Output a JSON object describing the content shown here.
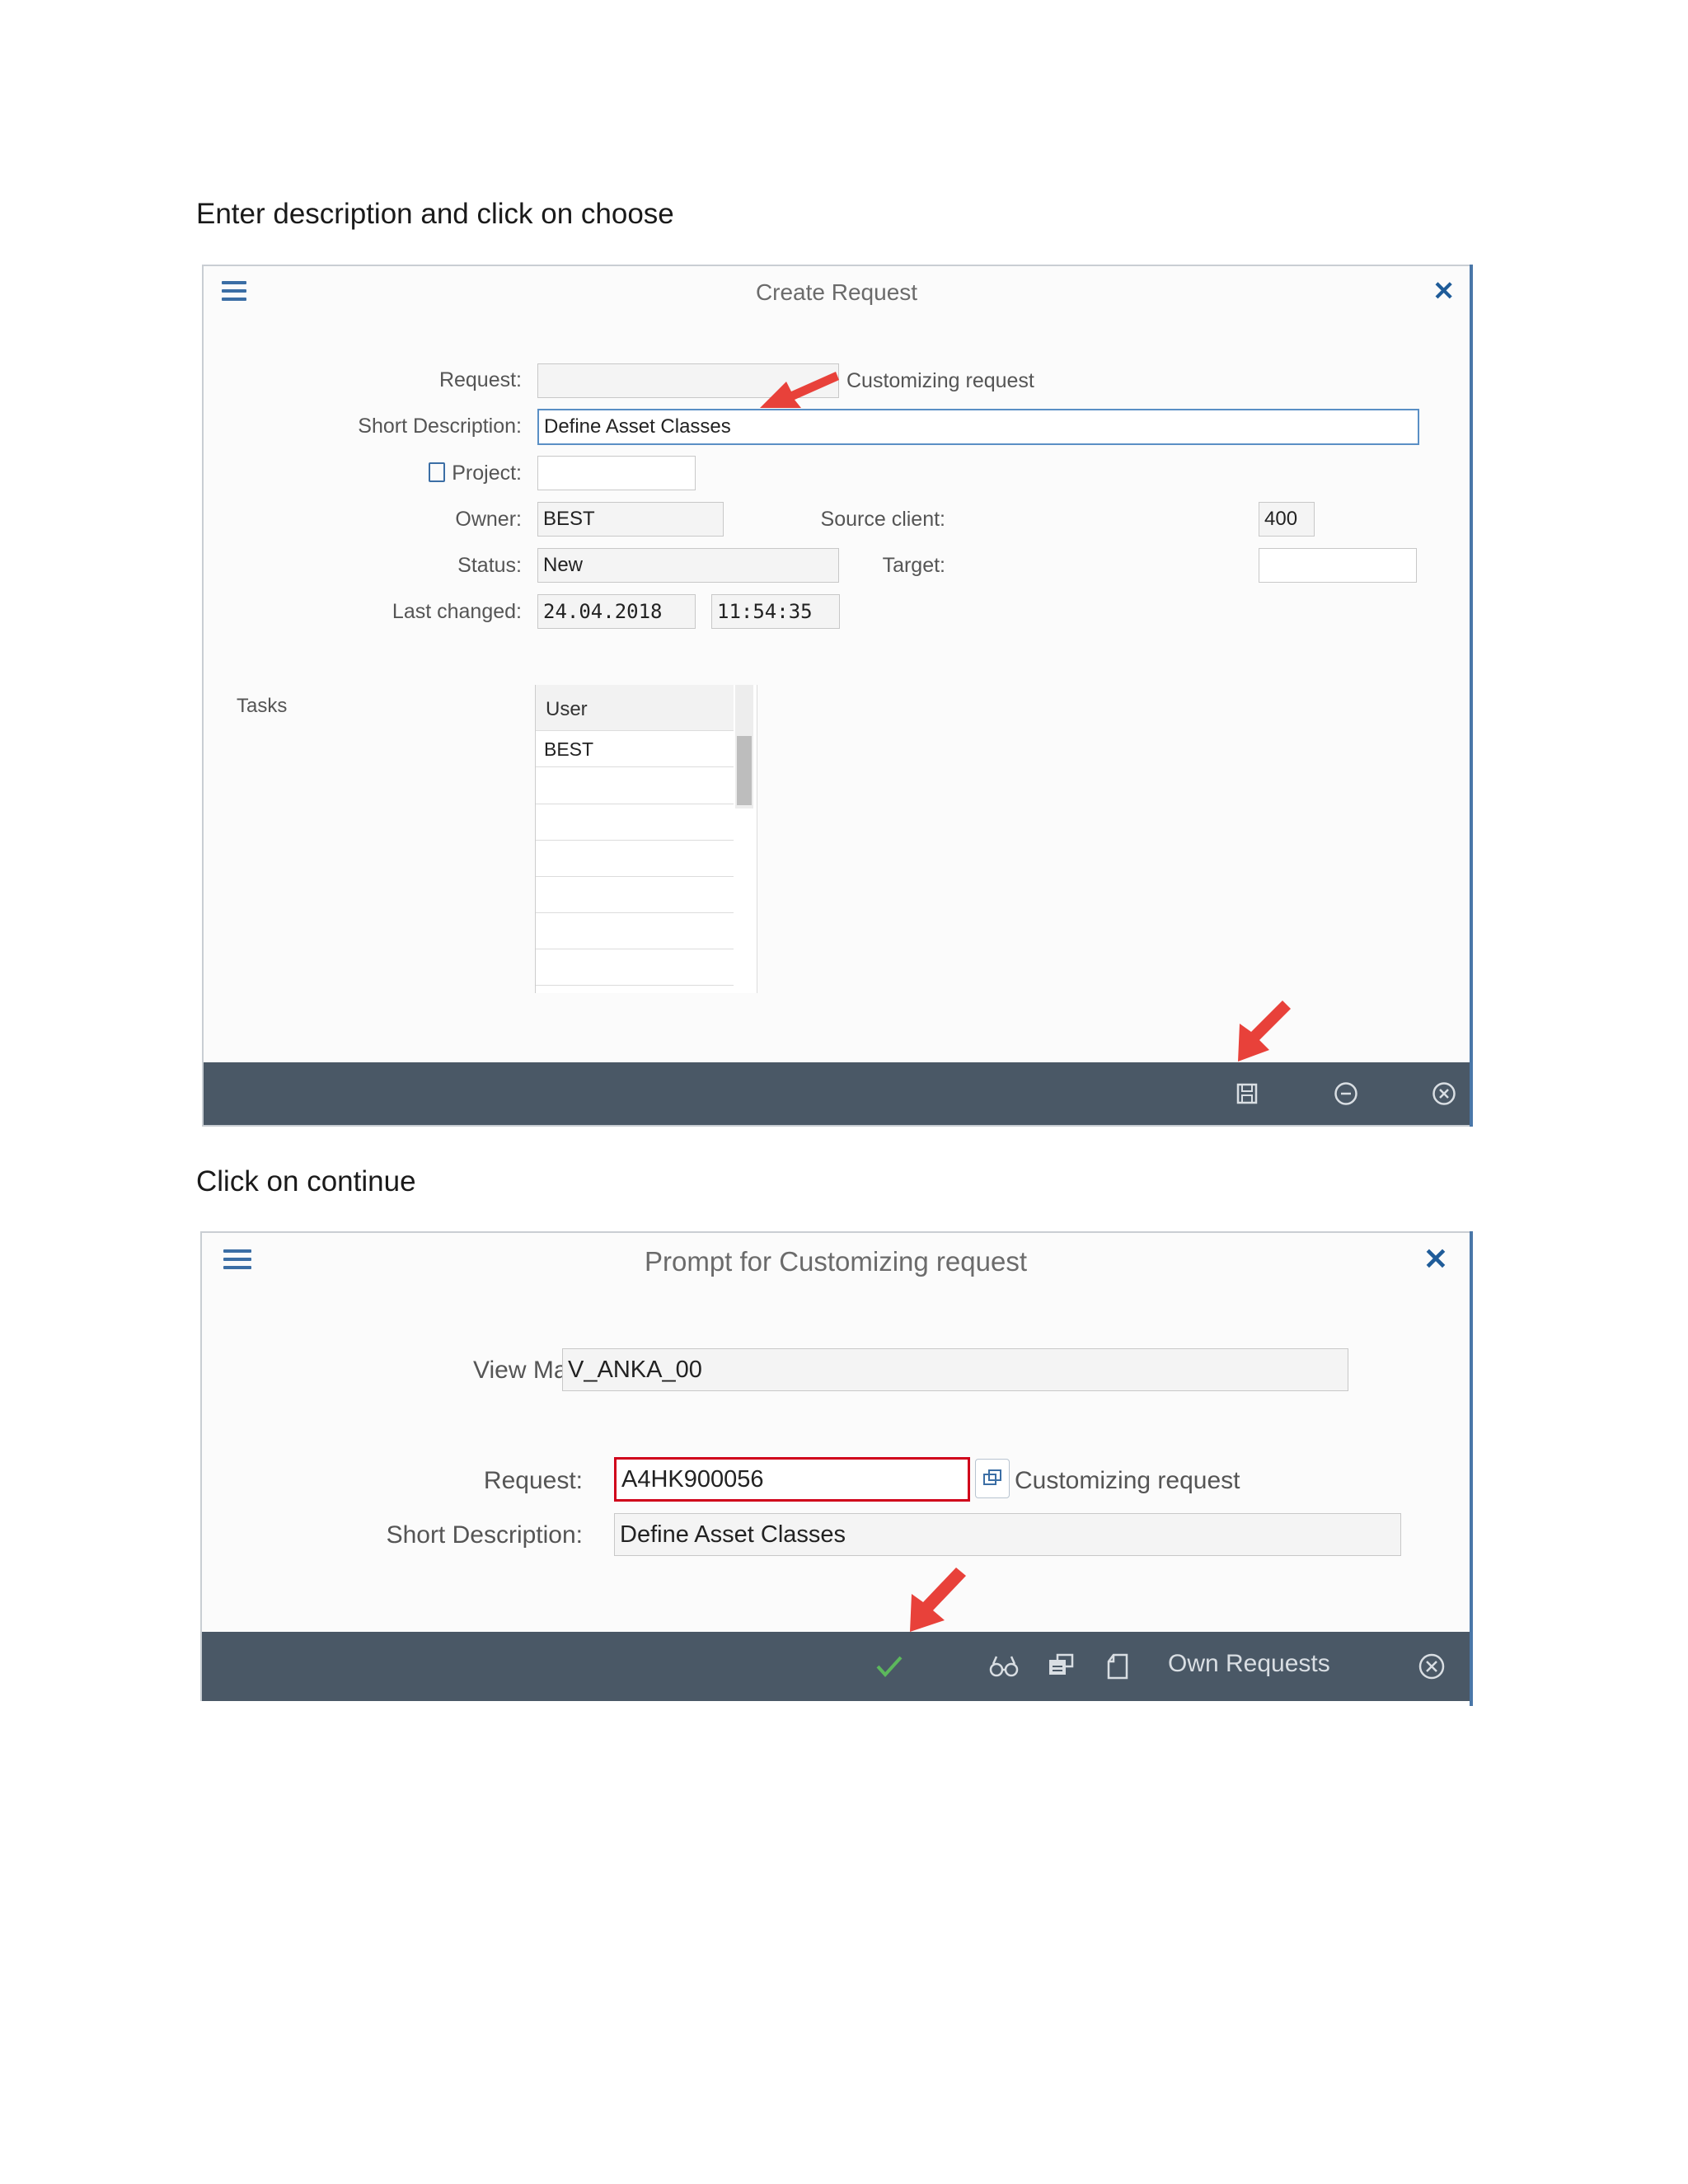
{
  "captions": {
    "first": "Enter description and click on choose",
    "second": "Click on continue"
  },
  "dialog1": {
    "title": "Create Request",
    "labels": {
      "request": "Request:",
      "short_description": "Short Description:",
      "project": "Project:",
      "owner": "Owner:",
      "status": "Status:",
      "last_changed": "Last changed:",
      "source_client": "Source client:",
      "target": "Target:",
      "tasks": "Tasks"
    },
    "values": {
      "request": "",
      "request_type": "Customizing request",
      "short_description": "Define Asset Classes",
      "project": "",
      "owner": "BEST",
      "status": "New",
      "date": "24.04.2018",
      "time": "11:54:35",
      "source_client": "400",
      "target": ""
    },
    "tasks_table": {
      "header": "User",
      "rows": [
        "BEST",
        "",
        "",
        "",
        "",
        "",
        ""
      ]
    },
    "footer_icons": [
      "save-icon",
      "minus-circle-icon",
      "cancel-circle-icon"
    ]
  },
  "dialog2": {
    "title": "Prompt for Customizing request",
    "labels": {
      "view_maintenance": "View Maintenance: Data:",
      "request": "Request:",
      "short_description": "Short Description:"
    },
    "values": {
      "view_maintenance": "V_ANKA_00",
      "request": "A4HK900056",
      "request_type": "Customizing request",
      "short_description": "Define Asset Classes"
    },
    "footer": {
      "own_requests": "Own Requests",
      "icons": [
        "checkmark-icon",
        "glasses-icon",
        "transport-icon",
        "new-document-icon",
        "cancel-circle-icon"
      ]
    }
  },
  "colors": {
    "footer_bar": "#4a5866",
    "accent_blue": "#1f5c99",
    "arrow_red": "#e8413a",
    "highlight_red": "#d0021b",
    "checkmark_green": "#5cb85c"
  }
}
